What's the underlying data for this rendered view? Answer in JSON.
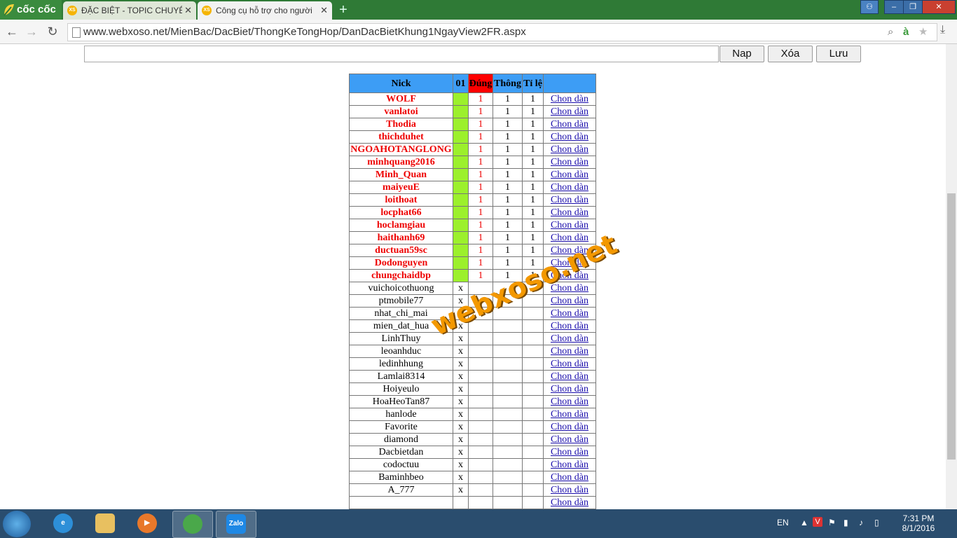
{
  "browser": {
    "logo_text": "cốc cốc",
    "tabs": [
      {
        "favicon": "XS",
        "title": "ĐẶC BIỆT - TOPIC CHUYÊN",
        "active": false
      },
      {
        "favicon": "XS",
        "title": "Công cụ hỗ trợ cho người",
        "active": true
      }
    ],
    "url": "www.webxoso.net/MienBac/DacBiet/ThongKeTongHop/DanDacBietKhung1NgayView2FR.aspx"
  },
  "toolbar": {
    "input_value": "",
    "nap_label": "Nap",
    "xoa_label": "Xóa",
    "luu_label": "Lưu"
  },
  "table": {
    "headers": {
      "nick": "Nick",
      "c01": "01",
      "dung": "Đúng",
      "thong": "Thông",
      "tile": "Tỉ lệ",
      "link": ""
    },
    "rows": [
      {
        "nick": "WOLF",
        "hit": true,
        "c01": "",
        "dung": "1",
        "thong": "1",
        "tile": "1",
        "link": "Chon dàn"
      },
      {
        "nick": "vanlatoi",
        "hit": true,
        "c01": "",
        "dung": "1",
        "thong": "1",
        "tile": "1",
        "link": "Chon dàn"
      },
      {
        "nick": "Thodia",
        "hit": true,
        "c01": "",
        "dung": "1",
        "thong": "1",
        "tile": "1",
        "link": "Chon dàn"
      },
      {
        "nick": "thichduhet",
        "hit": true,
        "c01": "",
        "dung": "1",
        "thong": "1",
        "tile": "1",
        "link": "Chon dàn"
      },
      {
        "nick": "NGOAHOTANGLONG",
        "hit": true,
        "c01": "",
        "dung": "1",
        "thong": "1",
        "tile": "1",
        "link": "Chon dàn"
      },
      {
        "nick": "minhquang2016",
        "hit": true,
        "c01": "",
        "dung": "1",
        "thong": "1",
        "tile": "1",
        "link": "Chon dàn"
      },
      {
        "nick": "Minh_Quan",
        "hit": true,
        "c01": "",
        "dung": "1",
        "thong": "1",
        "tile": "1",
        "link": "Chon dàn"
      },
      {
        "nick": "maiyeuE",
        "hit": true,
        "c01": "",
        "dung": "1",
        "thong": "1",
        "tile": "1",
        "link": "Chon dàn"
      },
      {
        "nick": "loithoat",
        "hit": true,
        "c01": "",
        "dung": "1",
        "thong": "1",
        "tile": "1",
        "link": "Chon dàn"
      },
      {
        "nick": "locphat66",
        "hit": true,
        "c01": "",
        "dung": "1",
        "thong": "1",
        "tile": "1",
        "link": "Chon dàn"
      },
      {
        "nick": "hoclamgiau",
        "hit": true,
        "c01": "",
        "dung": "1",
        "thong": "1",
        "tile": "1",
        "link": "Chon dàn"
      },
      {
        "nick": "haithanh69",
        "hit": true,
        "c01": "",
        "dung": "1",
        "thong": "1",
        "tile": "1",
        "link": "Chon dàn"
      },
      {
        "nick": "ductuan59sc",
        "hit": true,
        "c01": "",
        "dung": "1",
        "thong": "1",
        "tile": "1",
        "link": "Chon dàn"
      },
      {
        "nick": "Dodonguyen",
        "hit": true,
        "c01": "",
        "dung": "1",
        "thong": "1",
        "tile": "1",
        "link": "Chon dàn"
      },
      {
        "nick": "chungchaidbp",
        "hit": true,
        "c01": "",
        "dung": "1",
        "thong": "1",
        "tile": "1",
        "link": "Chon dàn"
      },
      {
        "nick": "vuichoicothuong",
        "hit": false,
        "c01": "x",
        "dung": "",
        "thong": "",
        "tile": "",
        "link": "Chon dàn"
      },
      {
        "nick": "ptmobile77",
        "hit": false,
        "c01": "x",
        "dung": "",
        "thong": "",
        "tile": "",
        "link": "Chon dàn"
      },
      {
        "nick": "nhat_chi_mai",
        "hit": false,
        "c01": "x",
        "dung": "",
        "thong": "",
        "tile": "",
        "link": "Chon dàn"
      },
      {
        "nick": "mien_dat_hua",
        "hit": false,
        "c01": "x",
        "dung": "",
        "thong": "",
        "tile": "",
        "link": "Chon dàn"
      },
      {
        "nick": "LinhThuy",
        "hit": false,
        "c01": "x",
        "dung": "",
        "thong": "",
        "tile": "",
        "link": "Chon dàn"
      },
      {
        "nick": "leoanhduc",
        "hit": false,
        "c01": "x",
        "dung": "",
        "thong": "",
        "tile": "",
        "link": "Chon dàn"
      },
      {
        "nick": "ledinhhung",
        "hit": false,
        "c01": "x",
        "dung": "",
        "thong": "",
        "tile": "",
        "link": "Chon dàn"
      },
      {
        "nick": "Lamlai8314",
        "hit": false,
        "c01": "x",
        "dung": "",
        "thong": "",
        "tile": "",
        "link": "Chon dàn"
      },
      {
        "nick": "Hoiyeulo",
        "hit": false,
        "c01": "x",
        "dung": "",
        "thong": "",
        "tile": "",
        "link": "Chon dàn"
      },
      {
        "nick": "HoaHeoTan87",
        "hit": false,
        "c01": "x",
        "dung": "",
        "thong": "",
        "tile": "",
        "link": "Chon dàn"
      },
      {
        "nick": "hanlode",
        "hit": false,
        "c01": "x",
        "dung": "",
        "thong": "",
        "tile": "",
        "link": "Chon dàn"
      },
      {
        "nick": "Favorite",
        "hit": false,
        "c01": "x",
        "dung": "",
        "thong": "",
        "tile": "",
        "link": "Chon dàn"
      },
      {
        "nick": "diamond",
        "hit": false,
        "c01": "x",
        "dung": "",
        "thong": "",
        "tile": "",
        "link": "Chon dàn"
      },
      {
        "nick": "Dacbietdan",
        "hit": false,
        "c01": "x",
        "dung": "",
        "thong": "",
        "tile": "",
        "link": "Chon dàn"
      },
      {
        "nick": "codoctuu",
        "hit": false,
        "c01": "x",
        "dung": "",
        "thong": "",
        "tile": "",
        "link": "Chon dàn"
      },
      {
        "nick": "Baminhbeo",
        "hit": false,
        "c01": "x",
        "dung": "",
        "thong": "",
        "tile": "",
        "link": "Chon dàn"
      },
      {
        "nick": "A_777",
        "hit": false,
        "c01": "x",
        "dung": "",
        "thong": "",
        "tile": "",
        "link": "Chon dàn"
      },
      {
        "nick": "",
        "hit": false,
        "c01": "",
        "dung": "",
        "thong": "",
        "tile": "",
        "link": "Chon dàn"
      }
    ]
  },
  "watermark": "webxoso.net",
  "colors": {
    "header_blue": "#3d9df5",
    "dung_red": "#ff0000",
    "hit_green": "#9cf02c",
    "hit_text": "#e00000"
  },
  "taskbar": {
    "lang": "EN",
    "time": "7:31 PM",
    "date": "8/1/2016",
    "zalo_label": "Zalo"
  }
}
